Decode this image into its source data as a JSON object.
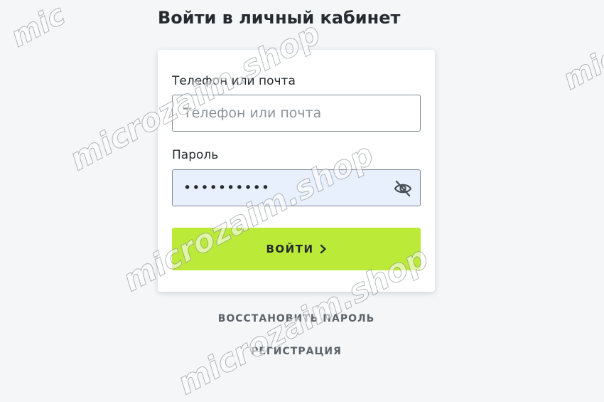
{
  "page": {
    "title": "Войти в личный кабинет"
  },
  "form": {
    "login_label": "Телефон или почта",
    "login_placeholder": "Телефон или почта",
    "login_value": "",
    "password_label": "Пароль",
    "password_value": "••••••••••",
    "password_toggle_icon": "eye-slash-icon",
    "submit_label": "ВОЙТИ",
    "submit_icon": "chevron-right-icon"
  },
  "links": {
    "recover_password": "ВОССТАНОВИТЬ ПАРОЛЬ",
    "register": "РЕГИСТРАЦИЯ"
  },
  "watermark": {
    "text": "microzaim.shop",
    "fragment_right": "micr",
    "fragment_left": "mic"
  },
  "colors": {
    "background": "#f4f6f8",
    "card": "#ffffff",
    "accent_button": "#bbeb38",
    "autofill_bg": "#e8f0fe",
    "text": "#262b2f",
    "link": "#5c6369"
  }
}
